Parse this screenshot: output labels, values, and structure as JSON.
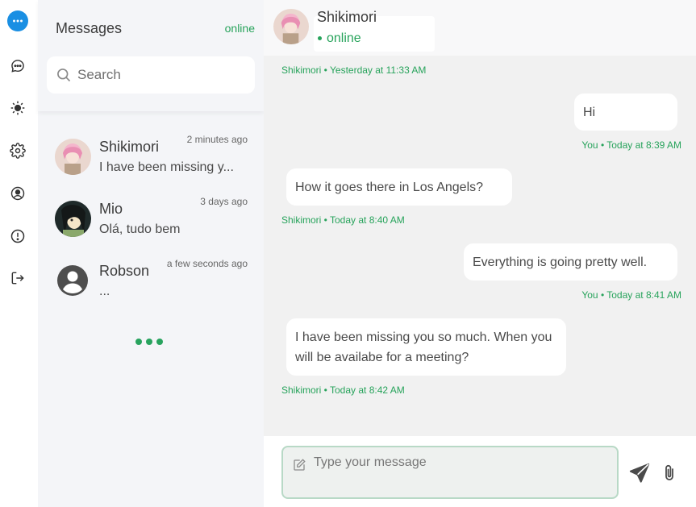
{
  "panel": {
    "title": "Messages",
    "status": "online",
    "search_placeholder": "Search"
  },
  "conversations": [
    {
      "name": "Shikimori",
      "time": "2 minutes ago",
      "preview": "I have been missing y..."
    },
    {
      "name": "Mio",
      "time": "3 days ago",
      "preview": "Olá, tudo bem"
    },
    {
      "name": "Robson",
      "time": "a few seconds ago",
      "preview": "..."
    }
  ],
  "chat": {
    "contact_name": "Shikimori",
    "contact_status": "online",
    "messages": [
      {
        "meta": "Shikimori • Yesterday at 11:33 AM"
      },
      {
        "text": "Hi",
        "meta": "You • Today at 8:39 AM"
      },
      {
        "text": "How it goes there in Los Angels?",
        "meta": "Shikimori • Today at 8:40 AM"
      },
      {
        "text": "Everything is going pretty well.",
        "meta": "You • Today at 8:41 AM"
      },
      {
        "text": "I have been missing you so much. When you will be availabe for a meeting?",
        "meta": "Shikimori • Today at 8:42 AM"
      }
    ],
    "input_placeholder": "Type your message"
  },
  "colors": {
    "accent": "#27a35b",
    "brand": "#1a8fe3"
  }
}
